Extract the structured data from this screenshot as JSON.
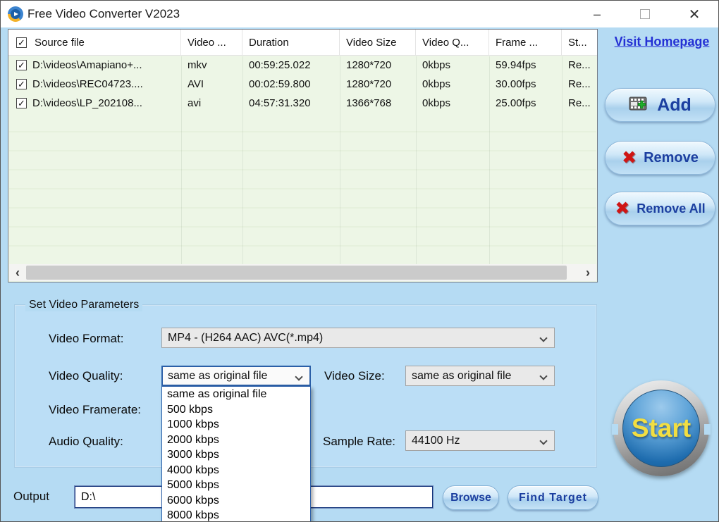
{
  "window": {
    "title": "Free Video Converter V2023"
  },
  "icons": {
    "checkmark": "✓",
    "minimize": "–",
    "close": "✕",
    "remove_x": "✖",
    "scroll_left": "‹",
    "scroll_right": "›"
  },
  "links": {
    "homepage": "Visit Homepage"
  },
  "file_table": {
    "columns": [
      "Source file",
      "Video ...",
      "Duration",
      "Video Size",
      "Video Q...",
      "Frame ...",
      "St..."
    ],
    "rows": [
      {
        "source": "D:\\videos\\Amapiano+...",
        "video": "mkv",
        "duration": "00:59:25.022",
        "size": "1280*720",
        "quality": "0kbps",
        "framerate": "59.94fps",
        "status": "Re..."
      },
      {
        "source": "D:\\videos\\REC04723....",
        "video": "AVI",
        "duration": "00:02:59.800",
        "size": "1280*720",
        "quality": "0kbps",
        "framerate": "30.00fps",
        "status": "Re..."
      },
      {
        "source": "D:\\videos\\LP_202108...",
        "video": "avi",
        "duration": "04:57:31.320",
        "size": "1366*768",
        "quality": "0kbps",
        "framerate": "25.00fps",
        "status": "Re..."
      }
    ]
  },
  "actions": {
    "add": "Add",
    "remove": "Remove",
    "remove_all": "Remove All"
  },
  "parameters": {
    "group_title": "Set Video Parameters",
    "video_format": {
      "label": "Video Format:",
      "value": "MP4 - (H264 AAC) AVC(*.mp4)"
    },
    "video_quality": {
      "label": "Video Quality:",
      "value": "same as original file",
      "options": [
        "same as original file",
        "500 kbps",
        "1000 kbps",
        "2000 kbps",
        "3000 kbps",
        "4000 kbps",
        "5000 kbps",
        "6000 kbps",
        "8000 kbps"
      ]
    },
    "video_size": {
      "label": "Video Size:",
      "value": "same as original file"
    },
    "video_framerate": {
      "label": "Video Framerate:"
    },
    "audio_quality": {
      "label": "Audio Quality:"
    },
    "sample_rate": {
      "label": "Sample Rate:",
      "value": "44100 Hz"
    }
  },
  "output": {
    "label": "Output",
    "path": "D:\\",
    "browse": "Browse",
    "find_target": "Find Target"
  },
  "start": {
    "label": "Start"
  }
}
